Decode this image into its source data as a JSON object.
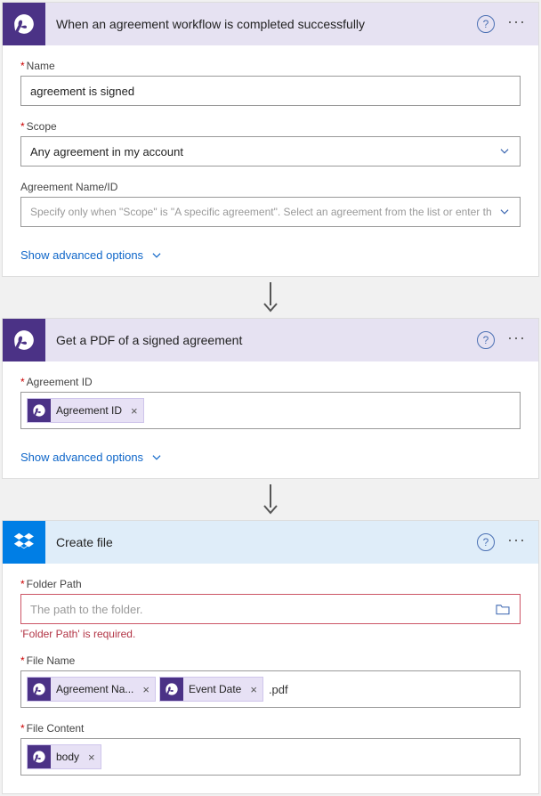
{
  "card1": {
    "title": "When an agreement workflow is completed successfully",
    "name_label": "Name",
    "name_value": "agreement is signed",
    "scope_label": "Scope",
    "scope_value": "Any agreement in my account",
    "agreement_label": "Agreement Name/ID",
    "agreement_placeholder": "Specify only when \"Scope\" is \"A specific agreement\". Select an agreement from the list or enter th",
    "adv": "Show advanced options"
  },
  "card2": {
    "title": "Get a PDF of a signed agreement",
    "agreement_label": "Agreement ID",
    "token_agreement": "Agreement ID",
    "adv": "Show advanced options"
  },
  "card3": {
    "title": "Create file",
    "folder_label": "Folder Path",
    "folder_placeholder": "The path to the folder.",
    "folder_error": "'Folder Path' is required.",
    "filename_label": "File Name",
    "token_agreement_name": "Agreement Na...",
    "token_event_date": "Event Date",
    "ext": ".pdf",
    "filecontent_label": "File Content",
    "token_body": "body"
  }
}
